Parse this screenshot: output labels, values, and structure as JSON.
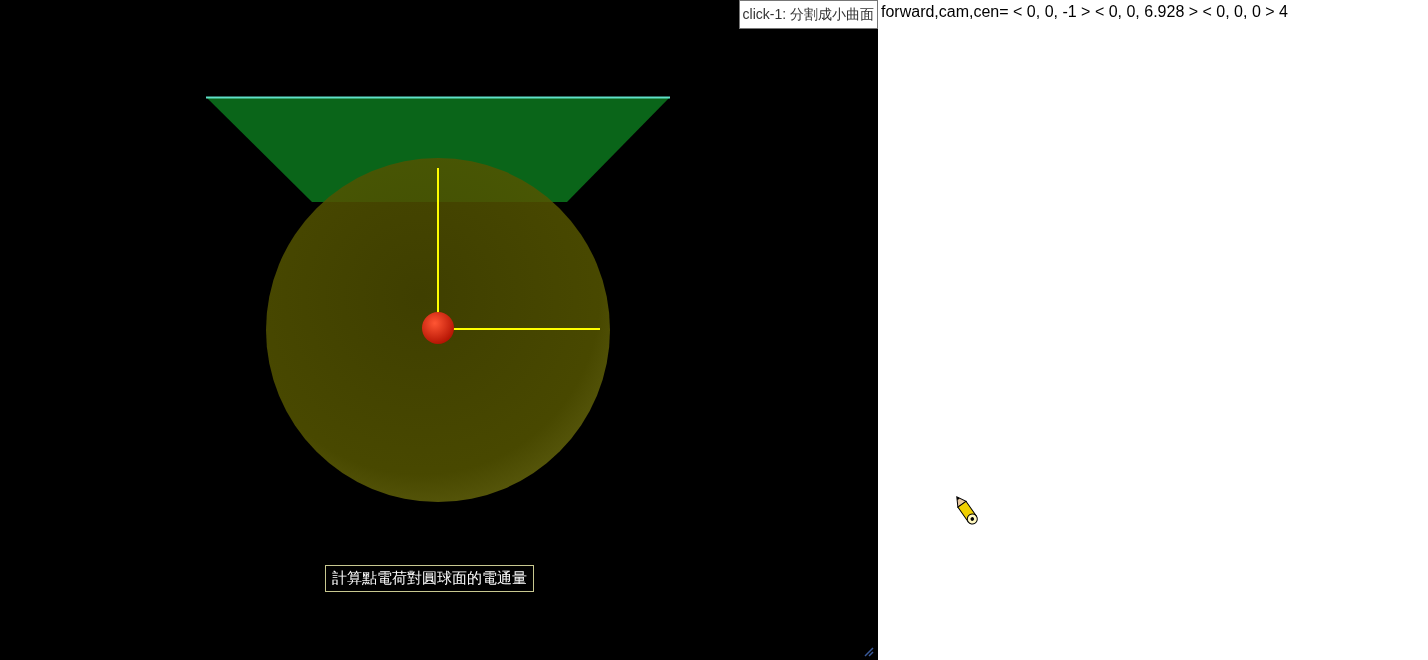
{
  "button": {
    "label": "click-1: 分割成小曲面"
  },
  "readout": "forward,cam,cen= < 0, 0, -1 > < 0, 0, 6.928 > < 0, 0, 0 > 4",
  "scene": {
    "caption": "計算點電荷對圓球面的電通量"
  }
}
